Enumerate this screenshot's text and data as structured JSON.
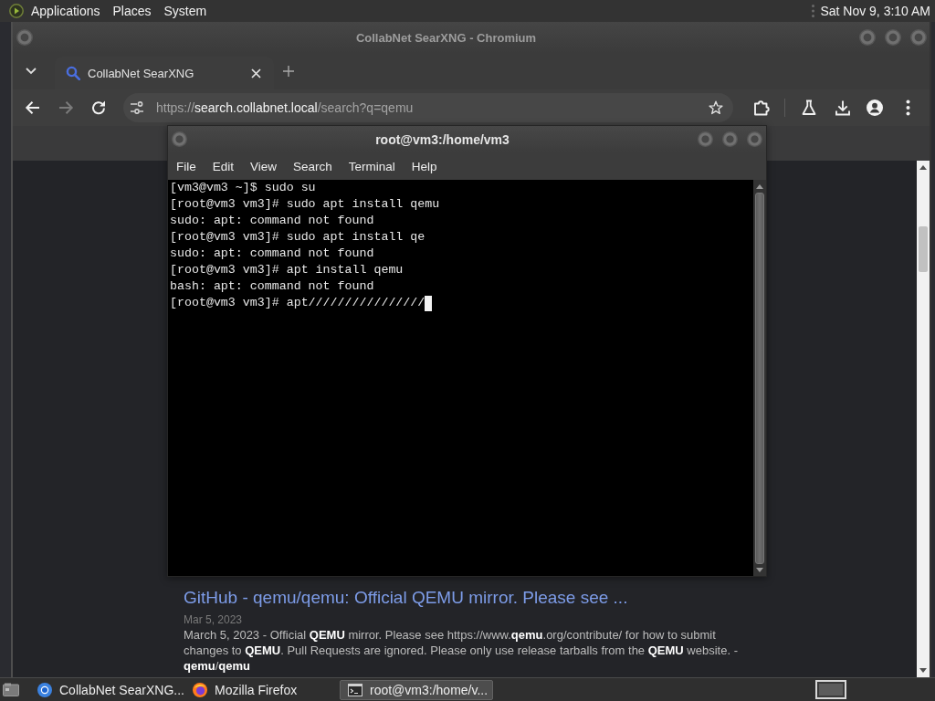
{
  "top_panel": {
    "menus": [
      "Applications",
      "Places",
      "System"
    ],
    "clock": "Sat Nov 9, 3:10 AM"
  },
  "browser": {
    "title": "CollabNet SearXNG - Chromium",
    "tabs": [
      {
        "label": "CollabNet SearXNG"
      }
    ],
    "nav_buttons": [
      {
        "kind": "back",
        "disabled": false
      },
      {
        "kind": "forward",
        "disabled": true
      },
      {
        "kind": "reload",
        "disabled": false
      }
    ],
    "address": [
      {
        "text": "https://",
        "emphasis": false
      },
      {
        "text": "search.collabnet.local",
        "emphasis": true
      },
      {
        "text": "/search?q=qemu",
        "emphasis": false
      }
    ],
    "result": {
      "title": "GitHub - qemu/qemu: Official QEMU mirror. Please see ...",
      "date": "Mar 5, 2023",
      "snippet": "March 5, 2023 - Official **QEMU** mirror. Please see https://www.**qemu**.org/contribute/ for how to submit changes to **QEMU**. Pull Requests are ignored. Please only use release tarballs from the **QEMU** website. - **qemu**/**qemu**"
    }
  },
  "terminal": {
    "title": "root@vm3:/home/vm3",
    "menus": [
      "File",
      "Edit",
      "View",
      "Search",
      "Terminal",
      "Help"
    ],
    "lines": [
      "[vm3@vm3 ~]$ sudo su",
      "[root@vm3 vm3]# sudo apt install qemu",
      "sudo: apt: command not found",
      "[root@vm3 vm3]# sudo apt install qe",
      "sudo: apt: command not found",
      "[root@vm3 vm3]# apt install qemu",
      "bash: apt: command not found",
      "[root@vm3 vm3]# apt////////////////"
    ],
    "cursor_visible": true
  },
  "taskbar": {
    "tasks": [
      {
        "label": "CollabNet SearXNG...",
        "kind": "chromium",
        "selected": false
      },
      {
        "label": "Mozilla Firefox",
        "kind": "firefox",
        "selected": false
      },
      {
        "label": "root@vm3:/home/v...",
        "kind": "terminal",
        "selected": true
      }
    ]
  }
}
